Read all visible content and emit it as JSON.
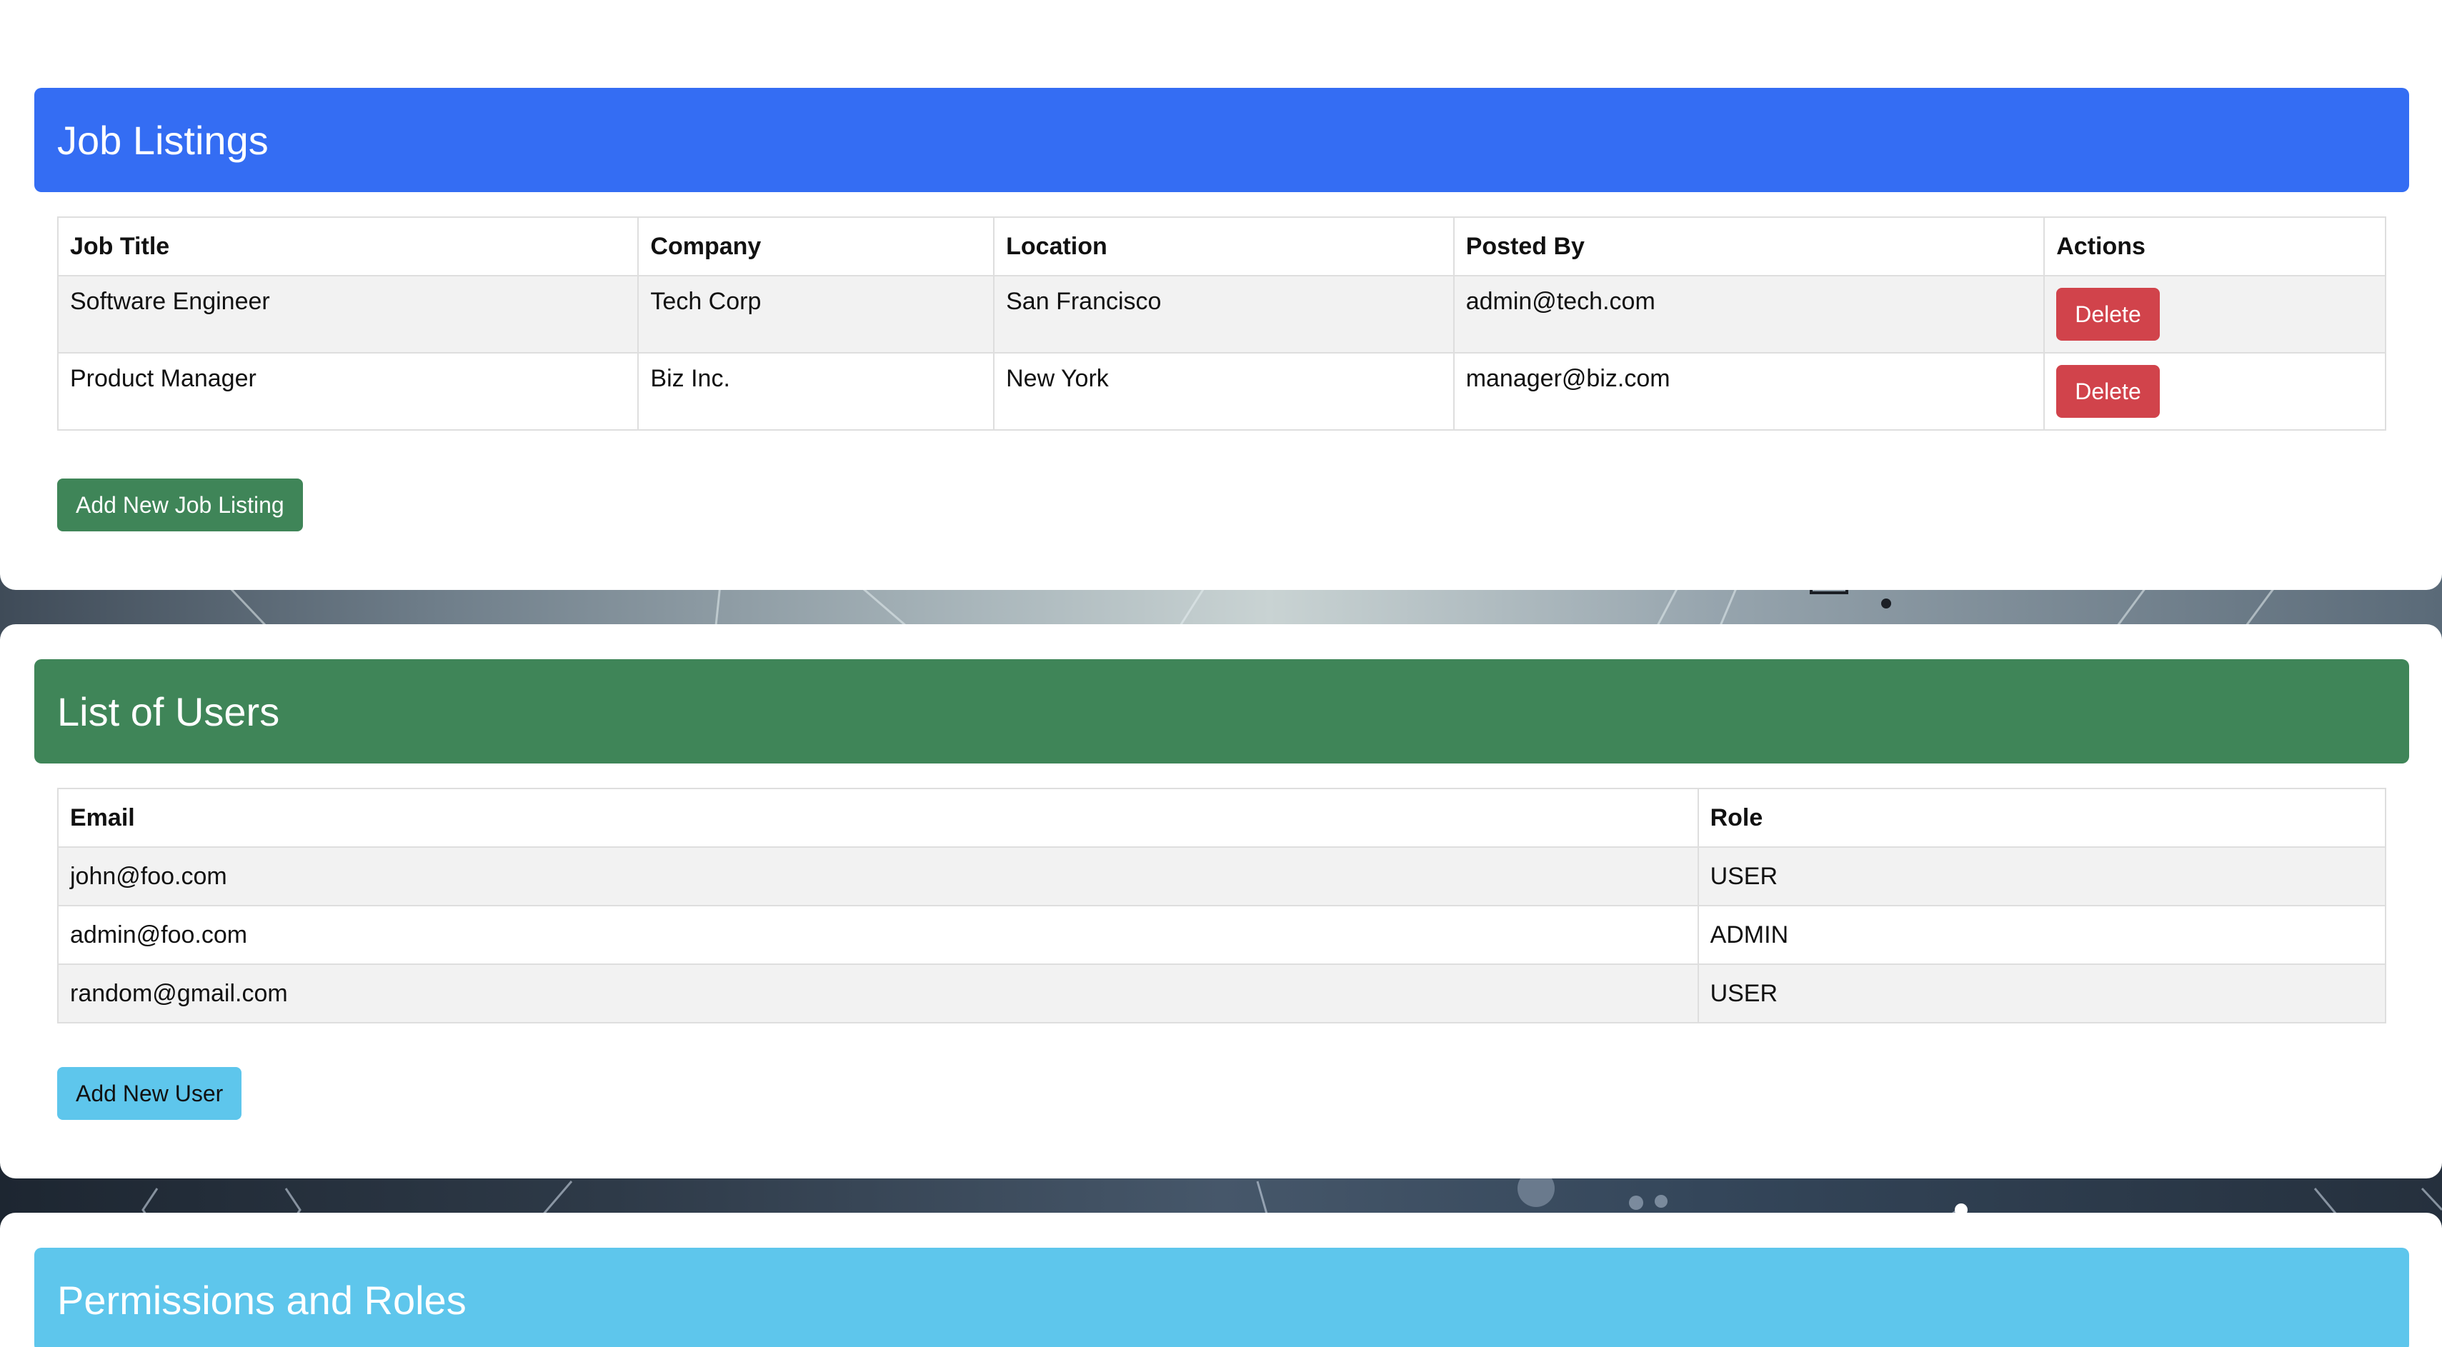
{
  "job_listings": {
    "title": "Job Listings",
    "columns": [
      "Job Title",
      "Company",
      "Location",
      "Posted By",
      "Actions"
    ],
    "rows": [
      {
        "title": "Software Engineer",
        "company": "Tech Corp",
        "location": "San Francisco",
        "posted_by": "admin@tech.com",
        "action": "Delete"
      },
      {
        "title": "Product Manager",
        "company": "Biz Inc.",
        "location": "New York",
        "posted_by": "manager@biz.com",
        "action": "Delete"
      }
    ],
    "add_button": "Add New Job Listing"
  },
  "users": {
    "title": "List of Users",
    "columns": [
      "Email",
      "Role"
    ],
    "rows": [
      {
        "email": "john@foo.com",
        "role": "USER"
      },
      {
        "email": "admin@foo.com",
        "role": "ADMIN"
      },
      {
        "email": "random@gmail.com",
        "role": "USER"
      }
    ],
    "add_button": "Add New User"
  },
  "permissions": {
    "title": "Permissions and Roles"
  },
  "colors": {
    "jobs_header": "#346df3",
    "users_header": "#3f8558",
    "permissions_header": "#5ec6ec",
    "delete_button": "#d1434b",
    "add_job_button": "#3f8558",
    "add_user_button": "#5ec6ec"
  }
}
